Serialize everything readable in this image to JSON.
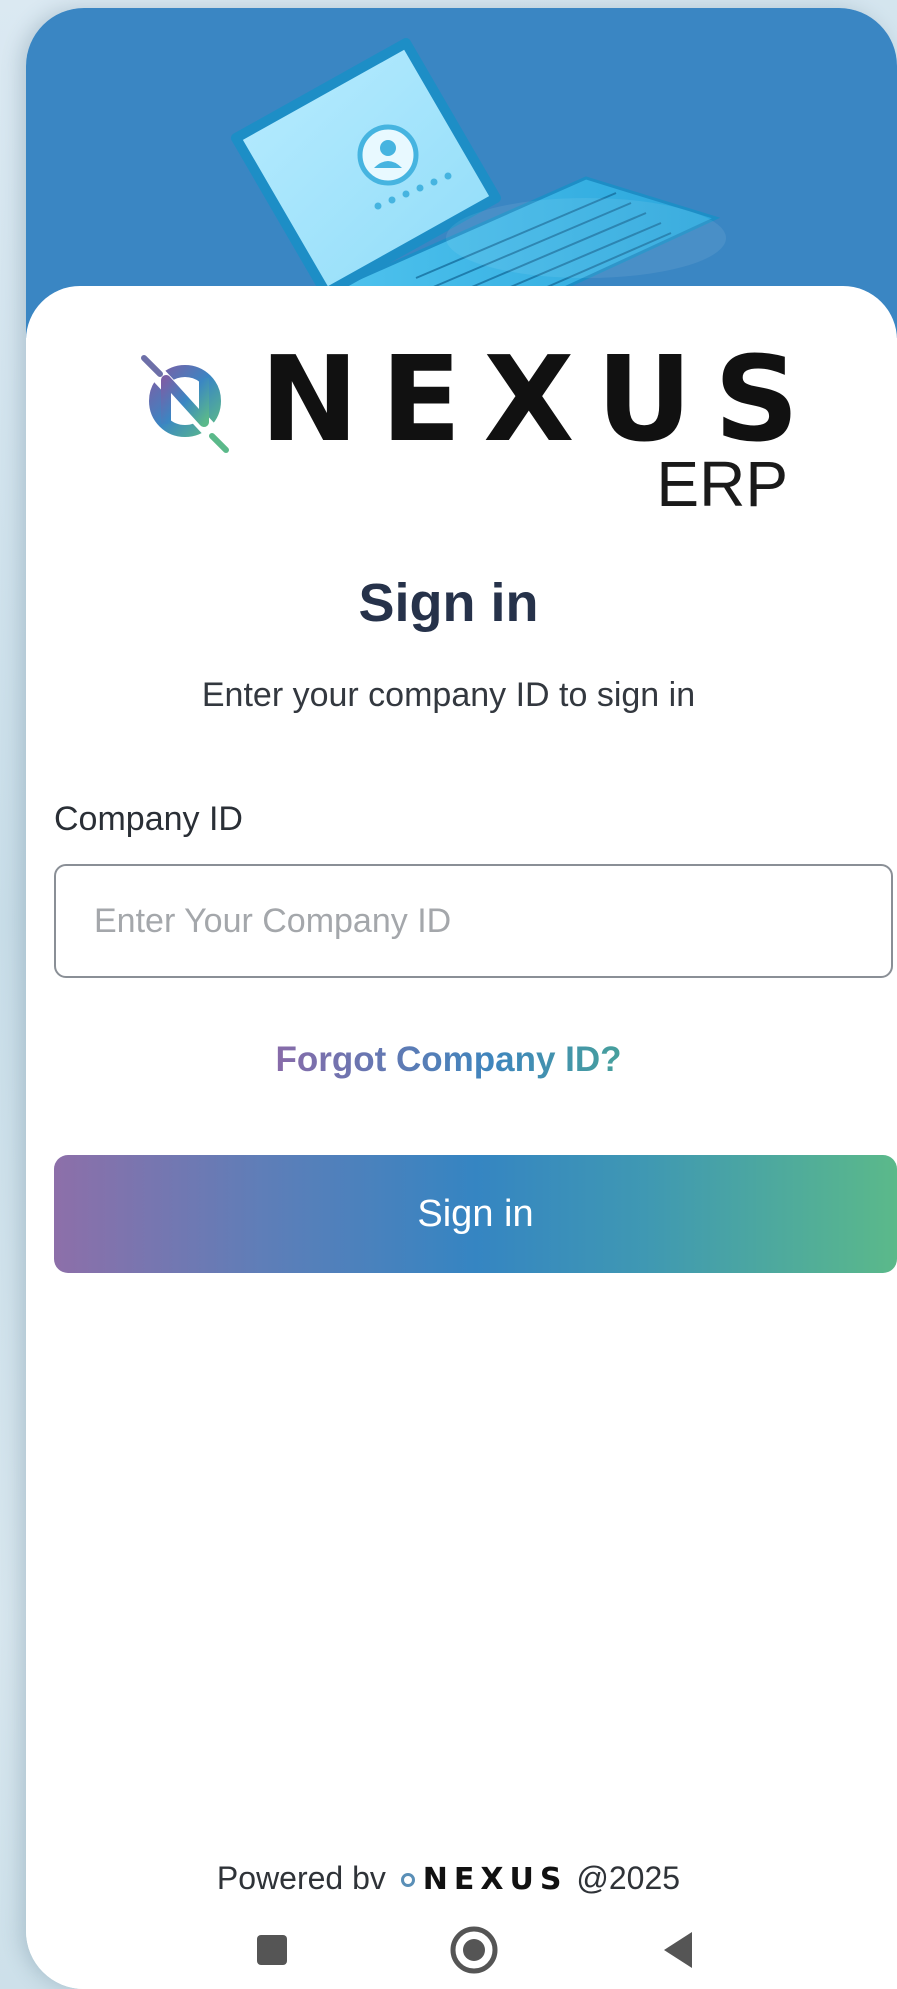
{
  "logo": {
    "word": "NEXUS",
    "sub": "ERP",
    "icon": "nexus-n-logo-icon"
  },
  "signin": {
    "title": "Sign in",
    "subtitle": "Enter your company ID to sign in",
    "field_label": "Company ID",
    "field_placeholder": "Enter Your Company ID",
    "field_value": "",
    "forgot_link": "Forgot Company ID?",
    "button_label": "Sign in"
  },
  "footer": {
    "powered_by": "Powered bv",
    "brand": "NEXUS",
    "year": "@2025"
  },
  "navbar": {
    "items": [
      "recents-square-icon",
      "home-circle-icon",
      "back-triangle-icon"
    ]
  },
  "colors": {
    "hero_blue": "#3a86c3",
    "title": "#26324a",
    "gradient_start": "#8d6fa9",
    "gradient_mid": "#3585c2",
    "gradient_end": "#5bb98a"
  }
}
